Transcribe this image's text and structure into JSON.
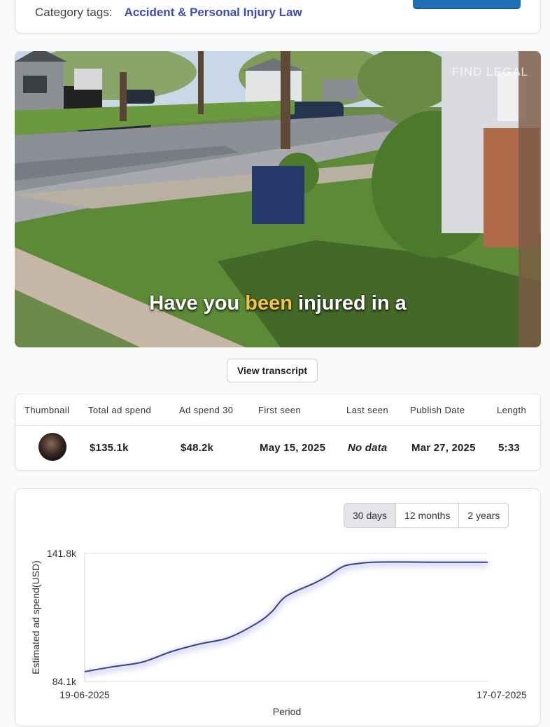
{
  "header": {
    "category_label": "Category tags:",
    "category_value": "Accident & Personal Injury Law"
  },
  "video": {
    "watermark": "FIND LEGAL",
    "caption_before": "Have you",
    "caption_highlight": "been",
    "caption_after": "injured in a"
  },
  "transcript_button": "View transcript",
  "table": {
    "headers": [
      "Thumbnail",
      "Total ad spend",
      "Ad spend 30",
      "First seen",
      "Last seen",
      "Publish Date",
      "Length"
    ],
    "row": {
      "total_ad_spend": "$135.1k",
      "ad_spend_30": "$48.2k",
      "first_seen": "May 15, 2025",
      "last_seen": "No data",
      "publish_date": "Mar 27, 2025",
      "length": "5:33"
    }
  },
  "range_options": [
    "30 days",
    "12 months",
    "2 years"
  ],
  "range_selected": "30 days",
  "colors": {
    "line": "#3b3f8f",
    "accent": "#3a4bb8",
    "button": "#1f6fb9"
  },
  "chart_data": {
    "type": "line",
    "ylabel": "Estimated ad spend(USD)",
    "xlabel": "Period",
    "y_tick_labels": [
      "84.1k",
      "141.8k"
    ],
    "x_tick_labels": [
      "19-06-2025",
      "17-07-2025"
    ],
    "ylim": [
      84.1,
      141.8
    ],
    "grid": true,
    "x": [
      0,
      2,
      4,
      6,
      8,
      10,
      12,
      13,
      14,
      16,
      17,
      18,
      19,
      20,
      22,
      24,
      26,
      28
    ],
    "values": [
      88.5,
      90.8,
      92.8,
      97.5,
      101.0,
      103.8,
      110.5,
      115.5,
      122.5,
      128.5,
      132.0,
      136.0,
      137.2,
      137.8,
      137.9,
      137.8,
      137.8,
      137.8
    ]
  }
}
